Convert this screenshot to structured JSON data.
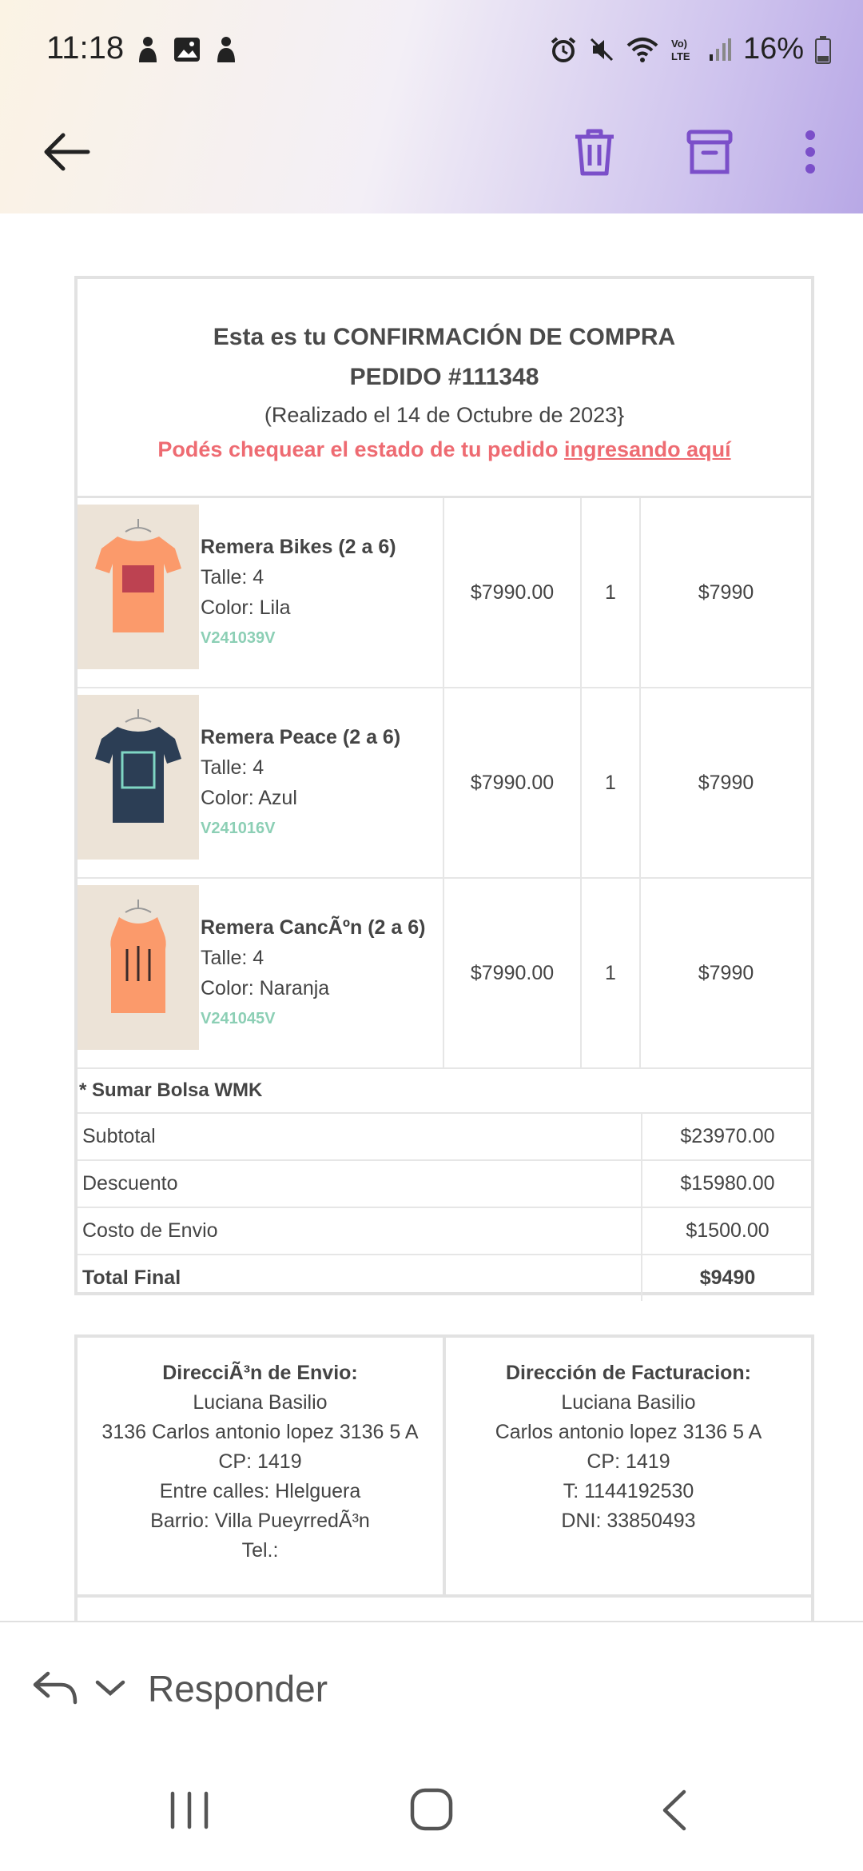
{
  "status": {
    "time": "11:18",
    "battery": "16%"
  },
  "header": {
    "title_line1": "Esta es tu CONFIRMACIÓN DE COMPRA",
    "title_line2": "PEDIDO #111348",
    "date_line": "(Realizado el 14 de Octubre de 2023}",
    "status_text": "Podés chequear el estado de tu pedido ",
    "status_link": "ingresando aquí"
  },
  "items": [
    {
      "name": "Remera Bikes (2 a 6)",
      "size": "Talle: 4",
      "color": "Color: Lila",
      "code": "V241039V",
      "unit_price": "$7990.00",
      "qty": "1",
      "total": "$7990",
      "shirt_color": "#fb9a6b",
      "print_color": "#b2334c"
    },
    {
      "name": "Remera Peace (2 a 6)",
      "size": "Talle: 4",
      "color": "Color: Azul",
      "code": "V241016V",
      "unit_price": "$7990.00",
      "qty": "1",
      "total": "$7990",
      "shirt_color": "#2c3e55",
      "print_color": "#7fd6c4"
    },
    {
      "name": "Remera CancÃºn (2 a 6)",
      "size": "Talle: 4",
      "color": "Color: Naranja",
      "code": "V241045V",
      "unit_price": "$7990.00",
      "qty": "1",
      "total": "$7990",
      "shirt_color": "#fb9a6b",
      "print_color": "#3a2a2a"
    }
  ],
  "bolsa": "* Sumar Bolsa WMK",
  "totals": {
    "subtotal_label": "Subtotal",
    "subtotal": "$23970.00",
    "discount_label": "Descuento",
    "discount": "$15980.00",
    "shipping_label": "Costo de Envio",
    "shipping": "$1500.00",
    "final_label": "Total Final",
    "final": "$9490"
  },
  "shipping_address": {
    "title": "DirecciÃ³n de Envio:",
    "name": "Luciana Basilio",
    "street": "3136 Carlos antonio lopez 3136 5 A",
    "cp": "CP: 1419",
    "between": "Entre calles: Hlelguera",
    "barrio": "Barrio: Villa PueyrredÃ³n",
    "tel": "Tel.:"
  },
  "billing_address": {
    "title": "Dirección de Facturacion:",
    "name": "Luciana Basilio",
    "street": "Carlos antonio lopez 3136 5 A",
    "cp": "CP: 1419",
    "phone": "T: 1144192530",
    "dni": "DNI: 33850493"
  },
  "reply": {
    "label": "Responder"
  },
  "colors": {
    "accent": "#7b4fc9",
    "link": "#ee6b72",
    "code": "#8ccfb5"
  }
}
